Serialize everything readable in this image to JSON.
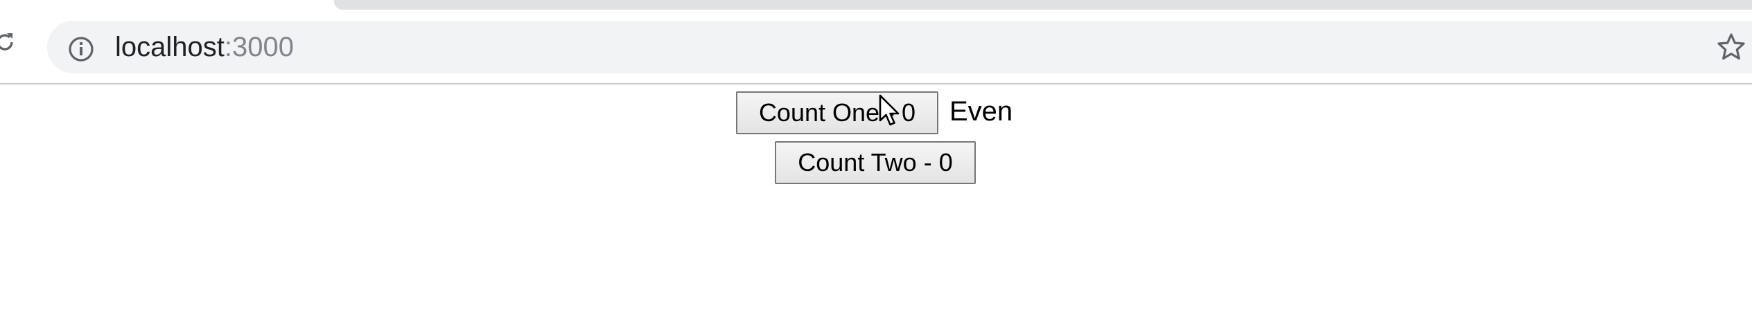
{
  "browser": {
    "url_host": "localhost",
    "url_port": ":3000"
  },
  "page": {
    "count_one_button": "Count One - 0",
    "parity_text": "Even",
    "count_two_button": "Count Two - 0"
  },
  "icons": {
    "reload": "reload-icon",
    "info": "info-icon",
    "bookmark": "star-icon",
    "cursor": "mouse-cursor-icon"
  }
}
